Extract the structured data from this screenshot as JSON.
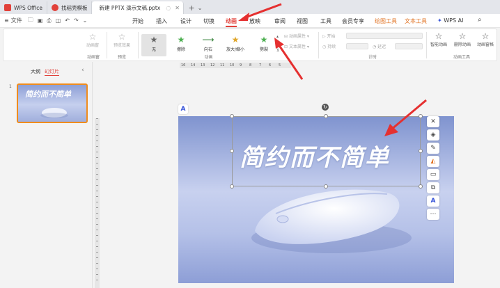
{
  "tabs": [
    {
      "label": "WPS Office",
      "color": "#e1413a"
    },
    {
      "label": "找稻壳模板",
      "color": "#e1413a"
    },
    {
      "label": "新建 PPTX 演示文稿.pptx",
      "color": "#e8761f"
    }
  ],
  "quick_access": {
    "file_label": "文件"
  },
  "menu": [
    {
      "label": "开始"
    },
    {
      "label": "插入"
    },
    {
      "label": "设计"
    },
    {
      "label": "切换"
    },
    {
      "label": "动画"
    },
    {
      "label": "放映"
    },
    {
      "label": "审阅"
    },
    {
      "label": "视图"
    },
    {
      "label": "工具"
    },
    {
      "label": "会员专享"
    },
    {
      "label": "绘图工具"
    },
    {
      "label": "文本工具"
    },
    {
      "label": "WPS AI"
    }
  ],
  "ribbon": {
    "preview_label": "预览效果",
    "preview_group": "预览",
    "pane_label": "动画窗",
    "pane_group": "动画窗",
    "effects": [
      {
        "label": "无",
        "icon": "star-outline-icon",
        "color": "#666666"
      },
      {
        "label": "擦除",
        "icon": "star-green-icon",
        "color": "#4caf50"
      },
      {
        "label": "向右",
        "icon": "line-arrow-icon",
        "color": "#2e7d32"
      },
      {
        "label": "放大/缩小",
        "icon": "star-yellow-icon",
        "color": "#e0a72c"
      },
      {
        "label": "劈裂",
        "icon": "star-green-icon",
        "color": "#4caf50"
      }
    ],
    "anim_group": "动画",
    "anim_props": "动画属性",
    "text_props": "文本属性",
    "timing": {
      "start": "开始",
      "duration": "持续",
      "delay": "延迟"
    },
    "timing_group": "计时",
    "tools": [
      {
        "label": "智能动画",
        "icon": "smart-star-icon"
      },
      {
        "label": "删除动画",
        "icon": "star-delete-icon"
      },
      {
        "label": "动画窗格",
        "icon": "star-pane-icon"
      }
    ],
    "tools_group": "动画工具"
  },
  "left_panel": {
    "outline_tab": "大纲",
    "slides_tab": "幻灯片",
    "slide_number": "1"
  },
  "ruler_ticks": [
    "16",
    "14",
    "13",
    "12",
    "11",
    "10",
    "9",
    "8",
    "7",
    "6",
    "5"
  ],
  "slide": {
    "title": "简约而不简单",
    "bg_color": "#a7b6e0",
    "mouse_color": "#eef1fb"
  },
  "colors": {
    "accent": "#e1413a",
    "selection_orange": "#f08c1c",
    "arrow_red": "#e53030"
  }
}
